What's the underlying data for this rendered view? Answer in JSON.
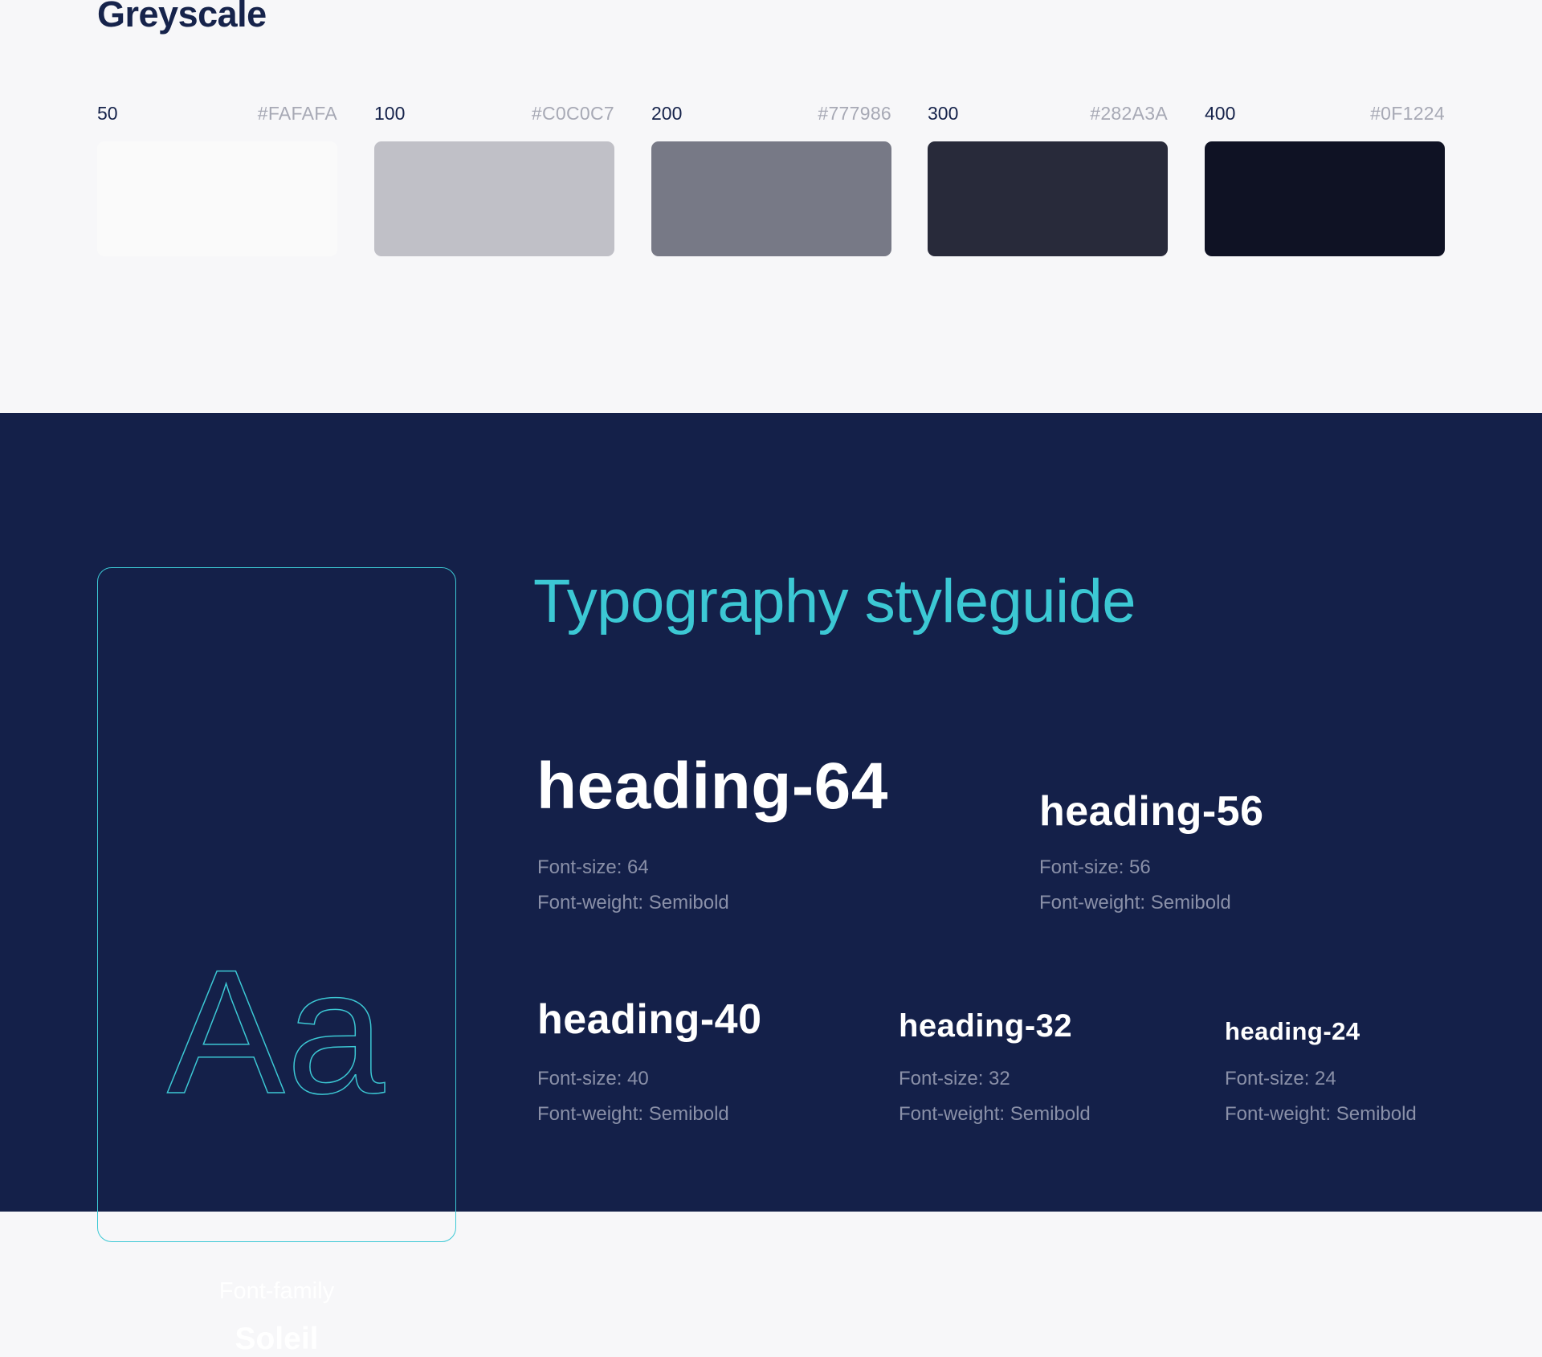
{
  "greyscale": {
    "title": "Greyscale",
    "swatches": [
      {
        "key": "50",
        "hex": "#FAFAFA",
        "color": "#FAFAFA"
      },
      {
        "key": "100",
        "hex": "#C0C0C7",
        "color": "#C0C0C7"
      },
      {
        "key": "200",
        "hex": "#777986",
        "color": "#777986"
      },
      {
        "key": "300",
        "hex": "#282A3A",
        "color": "#282A3A"
      },
      {
        "key": "400",
        "hex": "#0F1224",
        "color": "#0F1224"
      }
    ]
  },
  "typography": {
    "title": "Typography styleguide",
    "accent_color": "#3CC8D4",
    "background_color": "#142049",
    "font_card": {
      "glyph": "Aa",
      "label": "Font-family",
      "name": "Soleil"
    },
    "headings": [
      {
        "name": "heading-64",
        "size_text": "Font-size: 64",
        "weight_text": "Font-weight: Semibold"
      },
      {
        "name": "heading-56",
        "size_text": "Font-size: 56",
        "weight_text": "Font-weight: Semibold"
      },
      {
        "name": "heading-40",
        "size_text": "Font-size: 40",
        "weight_text": "Font-weight: Semibold"
      },
      {
        "name": "heading-32",
        "size_text": "Font-size: 32",
        "weight_text": "Font-weight: Semibold"
      },
      {
        "name": "heading-24",
        "size_text": "Font-size: 24",
        "weight_text": "Font-weight: Semibold"
      }
    ]
  }
}
